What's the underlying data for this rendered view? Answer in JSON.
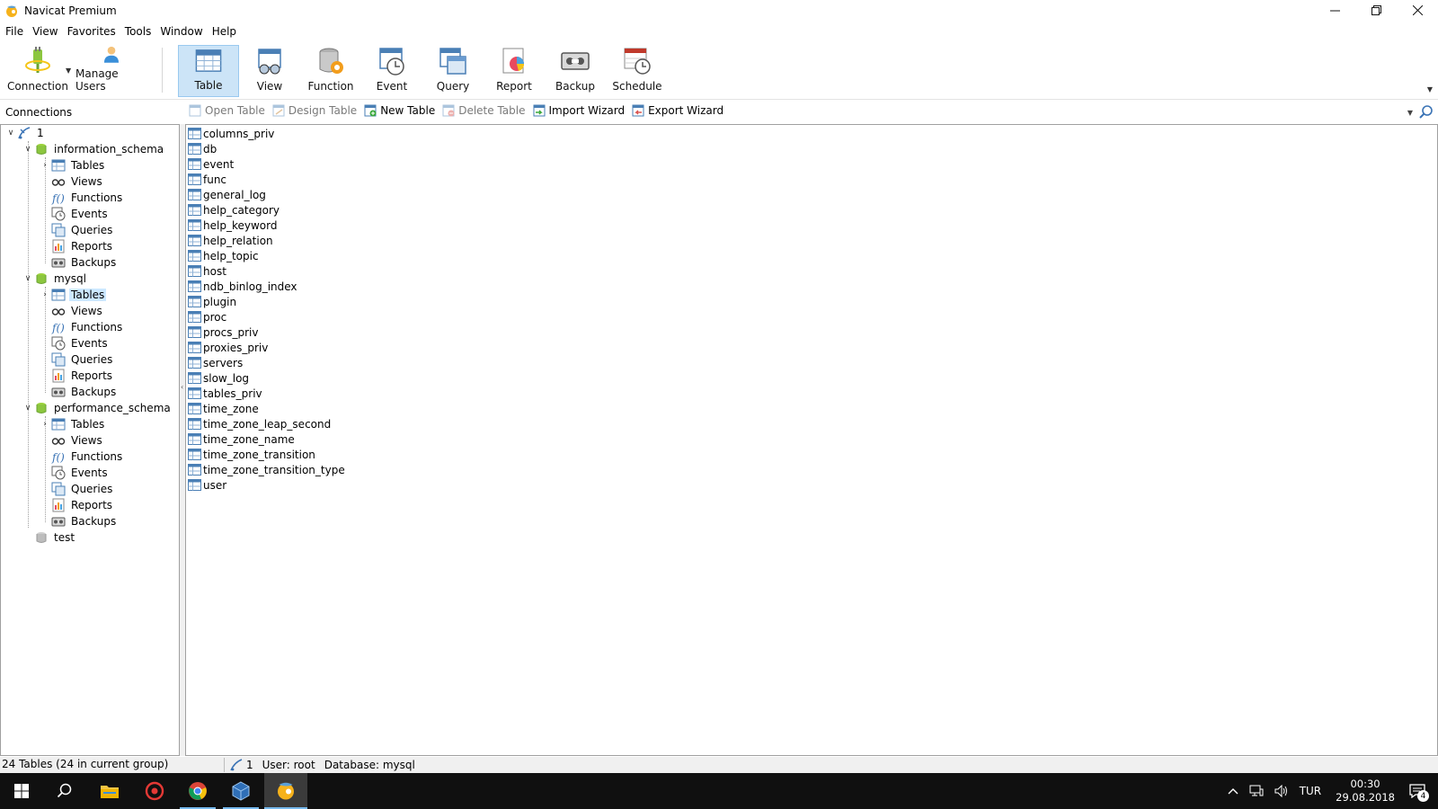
{
  "window": {
    "title": "Navicat Premium"
  },
  "menu": [
    "File",
    "View",
    "Favorites",
    "Tools",
    "Window",
    "Help"
  ],
  "toolbar": {
    "connection": "Connection",
    "manage_users": "Manage Users",
    "table": "Table",
    "view": "View",
    "function": "Function",
    "event": "Event",
    "query": "Query",
    "report": "Report",
    "backup": "Backup",
    "schedule": "Schedule"
  },
  "connections_label": "Connections",
  "object_toolbar": {
    "open_table": "Open Table",
    "design_table": "Design Table",
    "new_table": "New Table",
    "delete_table": "Delete Table",
    "import_wizard": "Import Wizard",
    "export_wizard": "Export Wizard"
  },
  "tree": {
    "connection": "1",
    "databases": [
      {
        "name": "information_schema",
        "items": [
          "Tables",
          "Views",
          "Functions",
          "Events",
          "Queries",
          "Reports",
          "Backups"
        ]
      },
      {
        "name": "mysql",
        "items": [
          "Tables",
          "Views",
          "Functions",
          "Events",
          "Queries",
          "Reports",
          "Backups"
        ]
      },
      {
        "name": "performance_schema",
        "items": [
          "Tables",
          "Views",
          "Functions",
          "Events",
          "Queries",
          "Reports",
          "Backups"
        ]
      },
      {
        "name": "test",
        "items": []
      }
    ]
  },
  "tables": [
    "columns_priv",
    "db",
    "event",
    "func",
    "general_log",
    "help_category",
    "help_keyword",
    "help_relation",
    "help_topic",
    "host",
    "ndb_binlog_index",
    "plugin",
    "proc",
    "procs_priv",
    "proxies_priv",
    "servers",
    "slow_log",
    "tables_priv",
    "time_zone",
    "time_zone_leap_second",
    "time_zone_name",
    "time_zone_transition",
    "time_zone_transition_type",
    "user"
  ],
  "status": {
    "count": "24 Tables (24 in current group)",
    "connection": "1",
    "user": "User: root",
    "database": "Database: mysql"
  },
  "taskbar": {
    "language": "TUR",
    "time": "00:30",
    "date": "29.08.2018",
    "notifications": "4"
  },
  "colors": {
    "accent": "#76b9ed",
    "selected": "#cce8ff",
    "toolbar_active": "#cce4f7"
  }
}
